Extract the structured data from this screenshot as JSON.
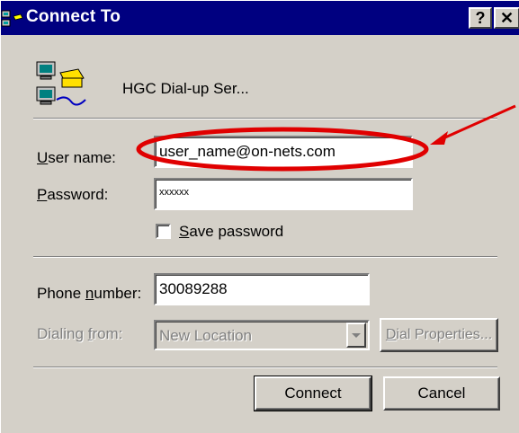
{
  "window": {
    "title": "Connect To",
    "help_button": "?",
    "close_button": "✕"
  },
  "connection": {
    "name": "HGC Dial-up Ser..."
  },
  "form": {
    "username_label_accel": "U",
    "username_label_rest": "ser name:",
    "username_value": "user_name@on-nets.com",
    "password_label_accel": "P",
    "password_label_rest": "assword:",
    "password_value": "xxxxxx",
    "save_password_accel": "S",
    "save_password_rest": "ave password",
    "save_password_checked": false,
    "phone_label_pre": "Phone ",
    "phone_label_accel": "n",
    "phone_label_rest": "umber:",
    "phone_value": "30089288",
    "dialing_label_pre": "Dialing ",
    "dialing_label_accel": "f",
    "dialing_label_rest": "rom:",
    "dialing_value": "New Location",
    "dial_props_accel": "D",
    "dial_props_rest": "ial Properties..."
  },
  "buttons": {
    "connect": "Connect",
    "cancel": "Cancel"
  },
  "annotation": {
    "color": "#e00000"
  }
}
